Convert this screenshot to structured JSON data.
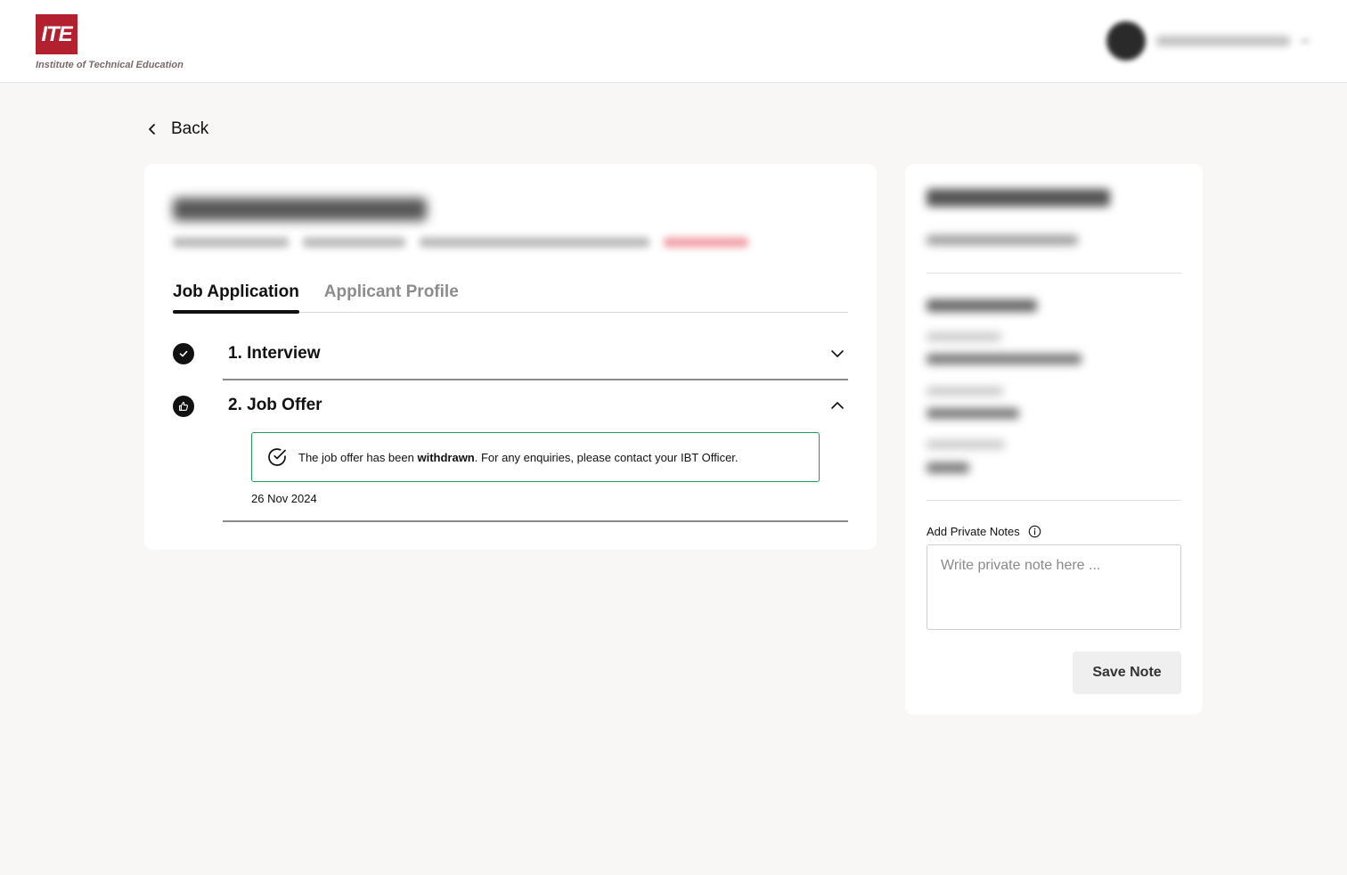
{
  "brand": {
    "logo_mark": "ITE",
    "logo_text": "Institute of Technical Education",
    "accent": "#b3202f"
  },
  "nav": {
    "back_label": "Back",
    "back_icon": "chevron-left-icon"
  },
  "tabs": [
    {
      "label": "Job Application",
      "active": true
    },
    {
      "label": "Applicant Profile",
      "active": false
    }
  ],
  "steps": [
    {
      "title": "1. Interview",
      "icon": "check-icon",
      "expanded": false,
      "chevron": "chevron-down-icon"
    },
    {
      "title": "2. Job Offer",
      "icon": "thumbs-up-icon",
      "expanded": true,
      "chevron": "chevron-up-icon"
    }
  ],
  "offer": {
    "alert_before": "The job offer has been ",
    "alert_bold": "withdrawn",
    "alert_after": ". For any enquiries, please contact your IBT Officer.",
    "date": "26 Nov 2024",
    "alert_border_color": "#1f9d55"
  },
  "notes": {
    "label": "Add Private Notes",
    "placeholder": "Write private note here ...",
    "value": "",
    "save_label": "Save Note"
  }
}
